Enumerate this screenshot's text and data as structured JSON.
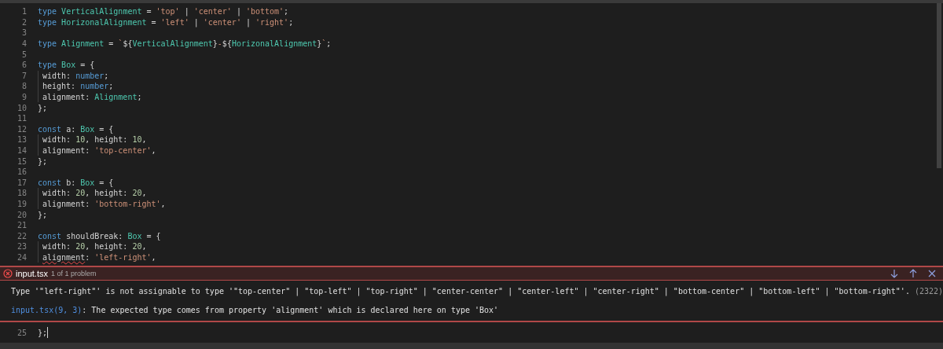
{
  "editor": {
    "lines": [
      {
        "number": "1",
        "guide": false,
        "tokens": [
          {
            "kind": "kw",
            "text": "type "
          },
          {
            "kind": "type",
            "text": "VerticalAlignment"
          },
          {
            "kind": "plain",
            "text": " = "
          },
          {
            "kind": "str",
            "text": "'top'"
          },
          {
            "kind": "plain",
            "text": " | "
          },
          {
            "kind": "str",
            "text": "'center'"
          },
          {
            "kind": "plain",
            "text": " | "
          },
          {
            "kind": "str",
            "text": "'bottom'"
          },
          {
            "kind": "plain",
            "text": ";"
          }
        ]
      },
      {
        "number": "2",
        "guide": false,
        "tokens": [
          {
            "kind": "kw",
            "text": "type "
          },
          {
            "kind": "type",
            "text": "HorizonalAlignment"
          },
          {
            "kind": "plain",
            "text": " = "
          },
          {
            "kind": "str",
            "text": "'left'"
          },
          {
            "kind": "plain",
            "text": " | "
          },
          {
            "kind": "str",
            "text": "'center'"
          },
          {
            "kind": "plain",
            "text": " | "
          },
          {
            "kind": "str",
            "text": "'right'"
          },
          {
            "kind": "plain",
            "text": ";"
          }
        ]
      },
      {
        "number": "3",
        "guide": false
      },
      {
        "number": "4",
        "guide": false,
        "tokens": [
          {
            "kind": "kw",
            "text": "type "
          },
          {
            "kind": "type",
            "text": "Alignment"
          },
          {
            "kind": "plain",
            "text": " = "
          },
          {
            "kind": "str",
            "text": "`"
          },
          {
            "kind": "plain",
            "text": "${"
          },
          {
            "kind": "type",
            "text": "VerticalAlignment"
          },
          {
            "kind": "plain",
            "text": "}"
          },
          {
            "kind": "str",
            "text": "-"
          },
          {
            "kind": "plain",
            "text": "${"
          },
          {
            "kind": "type",
            "text": "HorizonalAlignment"
          },
          {
            "kind": "plain",
            "text": "}"
          },
          {
            "kind": "str",
            "text": "`"
          },
          {
            "kind": "plain",
            "text": ";"
          }
        ]
      },
      {
        "number": "5",
        "guide": false
      },
      {
        "number": "6",
        "guide": false,
        "tokens": [
          {
            "kind": "kw",
            "text": "type "
          },
          {
            "kind": "type",
            "text": "Box"
          },
          {
            "kind": "plain",
            "text": " = {"
          }
        ]
      },
      {
        "number": "7",
        "guide": true,
        "tokens": [
          {
            "kind": "plain",
            "text": "width: "
          },
          {
            "kind": "kw",
            "text": "number"
          },
          {
            "kind": "plain",
            "text": ";"
          }
        ]
      },
      {
        "number": "8",
        "guide": true,
        "tokens": [
          {
            "kind": "plain",
            "text": "height: "
          },
          {
            "kind": "kw",
            "text": "number"
          },
          {
            "kind": "plain",
            "text": ";"
          }
        ]
      },
      {
        "number": "9",
        "guide": true,
        "tokens": [
          {
            "kind": "plain",
            "text": "alignment: "
          },
          {
            "kind": "type",
            "text": "Alignment"
          },
          {
            "kind": "plain",
            "text": ";"
          }
        ]
      },
      {
        "number": "10",
        "guide": false,
        "tokens": [
          {
            "kind": "plain",
            "text": "};"
          }
        ]
      },
      {
        "number": "11",
        "guide": false
      },
      {
        "number": "12",
        "guide": false,
        "tokens": [
          {
            "kind": "kw",
            "text": "const"
          },
          {
            "kind": "plain",
            "text": " a: "
          },
          {
            "kind": "type",
            "text": "Box"
          },
          {
            "kind": "plain",
            "text": " = {"
          }
        ]
      },
      {
        "number": "13",
        "guide": true,
        "tokens": [
          {
            "kind": "plain",
            "text": "width: "
          },
          {
            "kind": "num",
            "text": "10"
          },
          {
            "kind": "plain",
            "text": ", height: "
          },
          {
            "kind": "num",
            "text": "10"
          },
          {
            "kind": "plain",
            "text": ","
          }
        ]
      },
      {
        "number": "14",
        "guide": true,
        "tokens": [
          {
            "kind": "plain",
            "text": "alignment: "
          },
          {
            "kind": "str",
            "text": "'top-center'"
          },
          {
            "kind": "plain",
            "text": ","
          }
        ]
      },
      {
        "number": "15",
        "guide": false,
        "tokens": [
          {
            "kind": "plain",
            "text": "};"
          }
        ]
      },
      {
        "number": "16",
        "guide": false
      },
      {
        "number": "17",
        "guide": false,
        "tokens": [
          {
            "kind": "kw",
            "text": "const"
          },
          {
            "kind": "plain",
            "text": " b: "
          },
          {
            "kind": "type",
            "text": "Box"
          },
          {
            "kind": "plain",
            "text": " = {"
          }
        ]
      },
      {
        "number": "18",
        "guide": true,
        "tokens": [
          {
            "kind": "plain",
            "text": "width: "
          },
          {
            "kind": "num",
            "text": "20"
          },
          {
            "kind": "plain",
            "text": ", height: "
          },
          {
            "kind": "num",
            "text": "20"
          },
          {
            "kind": "plain",
            "text": ","
          }
        ]
      },
      {
        "number": "19",
        "guide": true,
        "tokens": [
          {
            "kind": "plain",
            "text": "alignment: "
          },
          {
            "kind": "str",
            "text": "'bottom-right'"
          },
          {
            "kind": "plain",
            "text": ","
          }
        ]
      },
      {
        "number": "20",
        "guide": false,
        "tokens": [
          {
            "kind": "plain",
            "text": "};"
          }
        ]
      },
      {
        "number": "21",
        "guide": false
      },
      {
        "number": "22",
        "guide": false,
        "tokens": [
          {
            "kind": "kw",
            "text": "const"
          },
          {
            "kind": "plain",
            "text": " shouldBreak: "
          },
          {
            "kind": "type",
            "text": "Box"
          },
          {
            "kind": "plain",
            "text": " = {"
          }
        ]
      },
      {
        "number": "23",
        "guide": true,
        "tokens": [
          {
            "kind": "plain",
            "text": "width: "
          },
          {
            "kind": "num",
            "text": "20"
          },
          {
            "kind": "plain",
            "text": ", height: "
          },
          {
            "kind": "num",
            "text": "20"
          },
          {
            "kind": "plain",
            "text": ","
          }
        ]
      },
      {
        "number": "24",
        "guide": true,
        "tokens": [
          {
            "kind": "error",
            "text": "alignment"
          },
          {
            "kind": "plain",
            "text": ": "
          },
          {
            "kind": "str",
            "text": "'left-right'"
          },
          {
            "kind": "plain",
            "text": ","
          }
        ]
      }
    ]
  },
  "problem_peek": {
    "file": "input.tsx",
    "count": "1 of 1 problem",
    "messages": [
      {
        "kind": "error",
        "text": "Type '\"left-right\"' is not assignable to type '\"top-center\" | \"top-left\" | \"top-right\" | \"center-center\" | \"center-left\" | \"center-right\" | \"bottom-center\" | \"bottom-left\" | \"bottom-right\"'.",
        "code": "(2322)"
      },
      {
        "kind": "related",
        "link": "input.tsx(9, 3)",
        "text": ": The expected type comes from property 'alignment' which is declared here on type 'Box'"
      }
    ]
  },
  "editor_after": {
    "lines": [
      {
        "number": "25",
        "guide": false,
        "cursor": true,
        "tokens": [
          {
            "kind": "plain",
            "text": "};"
          }
        ]
      }
    ]
  }
}
